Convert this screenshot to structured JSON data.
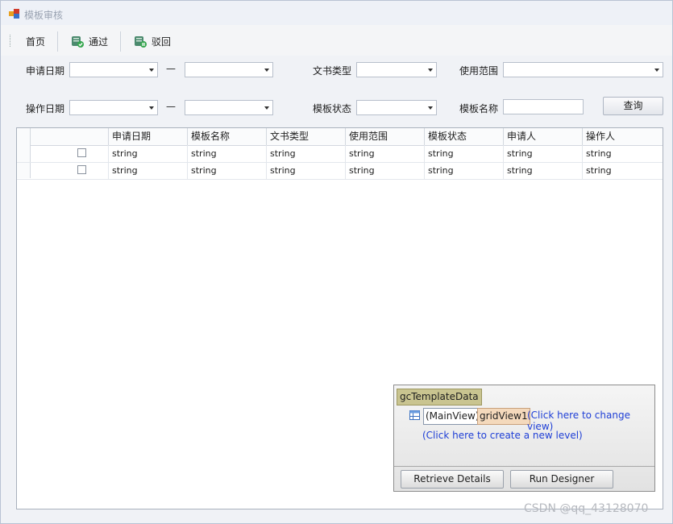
{
  "window": {
    "title": "模板审核"
  },
  "toolbar": {
    "home": "首页",
    "approve": "通过",
    "reject": "驳回"
  },
  "filters": {
    "apply_date": "申请日期",
    "operate_date": "操作日期",
    "dash": "—",
    "doc_type": "文书类型",
    "scope": "使用范围",
    "template_status": "模板状态",
    "template_name": "模板名称",
    "query": "查询"
  },
  "grid": {
    "columns": [
      "申请日期",
      "模板名称",
      "文书类型",
      "使用范围",
      "模板状态",
      "申请人",
      "操作人"
    ],
    "rows": [
      [
        "string",
        "string",
        "string",
        "string",
        "string",
        "string",
        "string"
      ],
      [
        "string",
        "string",
        "string",
        "string",
        "string",
        "string",
        "string"
      ]
    ]
  },
  "designer": {
    "gc_name": "gcTemplateData",
    "main_view": "(MainView)",
    "grid_view": "gridView1",
    "change_view": "(Click here to change view)",
    "new_level": "(Click here to create a new level)",
    "retrieve": "Retrieve Details",
    "run_designer": "Run Designer"
  },
  "watermark": "CSDN @qq_43128070"
}
